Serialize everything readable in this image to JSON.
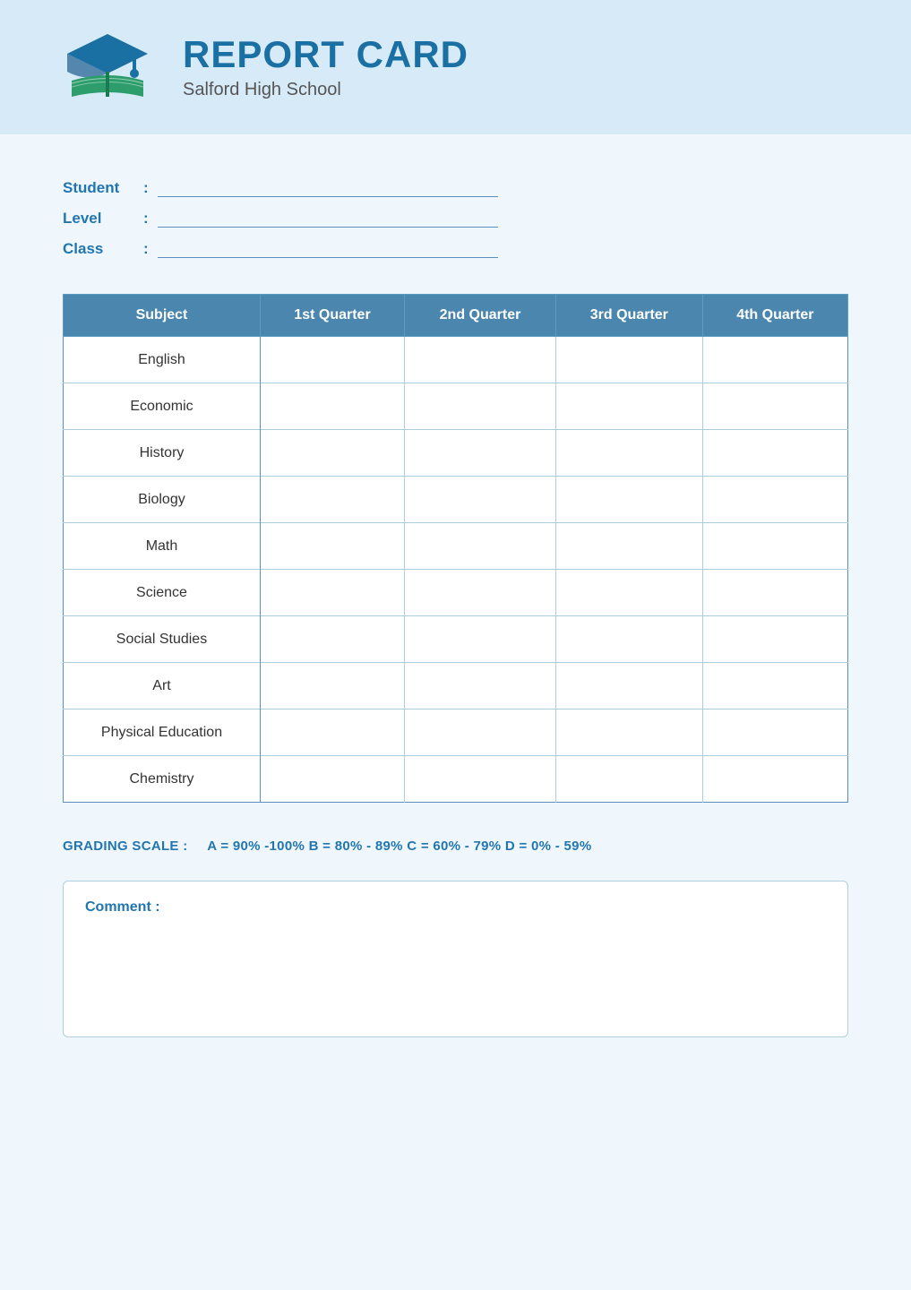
{
  "header": {
    "title": "REPORT CARD",
    "school": "Salford High School"
  },
  "student_info": {
    "student_label": "Student",
    "level_label": "Level",
    "class_label": "Class",
    "colon": ":"
  },
  "table": {
    "headers": [
      "Subject",
      "1st Quarter",
      "2nd Quarter",
      "3rd Quarter",
      "4th Quarter"
    ],
    "rows": [
      {
        "subject": "English",
        "q1": "",
        "q2": "",
        "q3": "",
        "q4": ""
      },
      {
        "subject": "Economic",
        "q1": "",
        "q2": "",
        "q3": "",
        "q4": ""
      },
      {
        "subject": "History",
        "q1": "",
        "q2": "",
        "q3": "",
        "q4": ""
      },
      {
        "subject": "Biology",
        "q1": "",
        "q2": "",
        "q3": "",
        "q4": ""
      },
      {
        "subject": "Math",
        "q1": "",
        "q2": "",
        "q3": "",
        "q4": ""
      },
      {
        "subject": "Science",
        "q1": "",
        "q2": "",
        "q3": "",
        "q4": ""
      },
      {
        "subject": "Social Studies",
        "q1": "",
        "q2": "",
        "q3": "",
        "q4": ""
      },
      {
        "subject": "Art",
        "q1": "",
        "q2": "",
        "q3": "",
        "q4": ""
      },
      {
        "subject": "Physical Education",
        "q1": "",
        "q2": "",
        "q3": "",
        "q4": ""
      },
      {
        "subject": "Chemistry",
        "q1": "",
        "q2": "",
        "q3": "",
        "q4": ""
      }
    ]
  },
  "grading_scale": {
    "label": "GRADING SCALE :",
    "text": "A = 90% -100%  B = 80% - 89%  C = 60% - 79%  D = 0% - 59%"
  },
  "comment": {
    "label": "Comment :"
  }
}
